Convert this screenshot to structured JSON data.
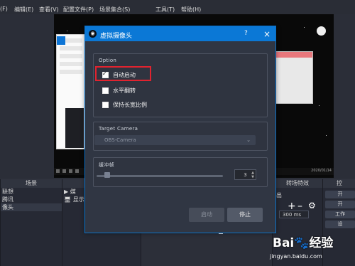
{
  "menubar": [
    {
      "label": "(F)"
    },
    {
      "label": "编辑(E)"
    },
    {
      "label": "查看(V)"
    },
    {
      "label": "配置文件(P)"
    },
    {
      "label": "场景集合(S)"
    },
    {
      "label": "工具(T)"
    },
    {
      "label": "帮助(H)"
    }
  ],
  "dialog": {
    "title": "虚拟摄像头",
    "help": "?",
    "close": "×",
    "option_group": "Option",
    "auto_start": "自动启动",
    "horizontal_flip": "水平翻转",
    "keep_ratio": "保持长宽比例",
    "target_group": "Target Camera",
    "target_value": "OBS-Camera",
    "buffer_group": "缓冲帧",
    "buffer_value": "3",
    "start_button": "启动",
    "stop_button": "停止"
  },
  "bottom": {
    "scenes_title": "场景",
    "scene_items": [
      "联想",
      "腾讯",
      "像头"
    ],
    "transition_title": "转场特效",
    "transition_duration": "300 ms",
    "controls_title": "控",
    "side_buttons": [
      "开",
      "开",
      "工作",
      "设"
    ],
    "source_items": [
      "▶ 媒",
      "🖥 显示"
    ],
    "left_label": "出"
  },
  "preview": {
    "title_bar": "",
    "clock": "2020/01/14"
  },
  "watermark": {
    "brand": "Bai",
    "suffix": "经验",
    "url": "jingyan.baidu.com"
  }
}
